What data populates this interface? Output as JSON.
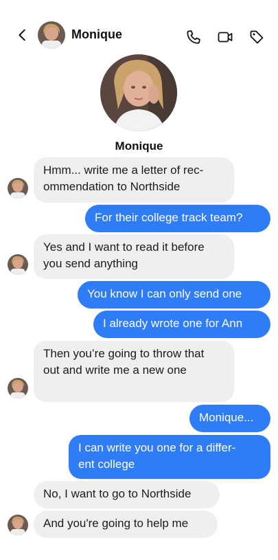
{
  "header": {
    "contact_name": "Monique",
    "icons": [
      "back-chevron-icon",
      "phone-icon",
      "video-icon",
      "tag-icon"
    ]
  },
  "profile": {
    "name": "Monique"
  },
  "messages": [
    {
      "from": "them",
      "lines": [
        "Hmm... write me a letter of rec-",
        "ommendation to Northside"
      ]
    },
    {
      "from": "me",
      "lines": [
        "For their college track team?"
      ]
    },
    {
      "from": "them",
      "lines": [
        "Yes and I want to read it before",
        "you send anything"
      ]
    },
    {
      "from": "me",
      "lines": [
        "You know I can only send one"
      ]
    },
    {
      "from": "me",
      "lines": [
        "I already wrote one for Ann"
      ]
    },
    {
      "from": "them",
      "lines": [
        "Then you’re going to throw that",
        "out and write me a new one"
      ]
    },
    {
      "from": "me",
      "lines": [
        "Monique..."
      ]
    },
    {
      "from": "me",
      "lines": [
        "I can write you one for a differ-",
        "ent college"
      ]
    },
    {
      "from": "them",
      "lines": [
        "No, I want to go to Northside"
      ]
    },
    {
      "from": "them",
      "lines": [
        "And you're going to help me"
      ]
    }
  ],
  "colors": {
    "outgoing_bubble": "#2e7cf6",
    "incoming_bubble": "#efefef",
    "background": "#ffffff"
  }
}
